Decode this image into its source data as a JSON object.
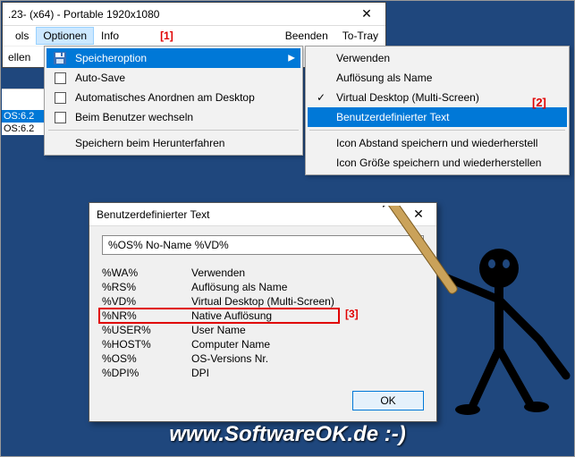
{
  "window": {
    "title": ".23- (x64) - Portable 1920x1080",
    "menubar": {
      "tools": "ols",
      "options": "Optionen",
      "info": "Info",
      "quit": "Beenden",
      "totray": "To-Tray"
    },
    "body_label": "ellen",
    "rows": [
      "OS:6.2",
      "OS:6.2"
    ]
  },
  "annotations": {
    "n1": "[1]",
    "n2": "[2]",
    "n3": "[3]"
  },
  "menu1": {
    "storage": "Speicheroption",
    "autosave": "Auto-Save",
    "autoarrange": "Automatisches Anordnen am Desktop",
    "userchange": "Beim Benutzer wechseln",
    "shutdown": "Speichern beim Herunterfahren"
  },
  "menu2": {
    "use": "Verwenden",
    "resname": "Auflösung als Name",
    "vd": "Virtual Desktop (Multi-Screen)",
    "custom": "Benutzerdefinierter Text",
    "iconspacing": "Icon Abstand speichern und wiederherstell",
    "iconsize": "Icon Größe speichern und wiederherstellen"
  },
  "dialog": {
    "title": "Benutzerdefinierter Text",
    "input_value": "%OS% No-Name %VD%",
    "rows": [
      {
        "var": "%WA%",
        "desc": "Verwenden"
      },
      {
        "var": "%RS%",
        "desc": "Auflösung als Name"
      },
      {
        "var": "%VD%",
        "desc": "Virtual Desktop (Multi-Screen)"
      },
      {
        "var": "%NR%",
        "desc": "Native Auflösung"
      },
      {
        "var": "%USER%",
        "desc": "User Name"
      },
      {
        "var": "%HOST%",
        "desc": "Computer Name"
      },
      {
        "var": "%OS%",
        "desc": "OS-Versions Nr."
      },
      {
        "var": "%DPI%",
        "desc": "DPI"
      }
    ],
    "ok": "OK"
  },
  "footer": "www.SoftwareOK.de :-)"
}
